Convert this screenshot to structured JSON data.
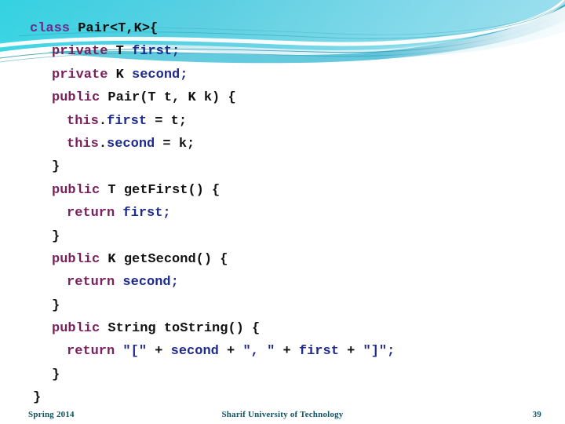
{
  "slide": {
    "page_number": "39",
    "footer": {
      "date": "Spring 2014",
      "organization": "Sharif University of Technology"
    },
    "decoration": {
      "name": "cyan-swoosh-banner",
      "colors": {
        "cyan_bright": "#3fd6e0",
        "cyan_mid": "#5fc8dd",
        "cyan_pale": "#b8e6f0",
        "cyan_line": "#1f8fa5",
        "teal_line": "#2e9fb5",
        "sky": "#7ec9e8"
      }
    },
    "syntax_colors": {
      "keyword": "#7a1f5c",
      "class_keyword": "#6b2a8e",
      "identifier": "#1d2a8f",
      "plain": "#111111"
    }
  },
  "code": {
    "language": "java",
    "lines": [
      {
        "indent": 0,
        "tokens": [
          {
            "t": "class ",
            "c": "cls"
          },
          {
            "t": "Pair<T,K>{",
            "c": "pl"
          }
        ]
      },
      {
        "indent": 1,
        "tokens": [
          {
            "t": "private ",
            "c": "kw"
          },
          {
            "t": "T ",
            "c": "pl"
          },
          {
            "t": "first;",
            "c": "id"
          }
        ]
      },
      {
        "indent": 1,
        "tokens": [
          {
            "t": "private ",
            "c": "kw"
          },
          {
            "t": "K ",
            "c": "pl"
          },
          {
            "t": "second;",
            "c": "id"
          }
        ]
      },
      {
        "indent": 1,
        "tokens": [
          {
            "t": "public ",
            "c": "kw"
          },
          {
            "t": "Pair(T t, K k) {",
            "c": "pl"
          }
        ]
      },
      {
        "indent": 2,
        "tokens": [
          {
            "t": "this",
            "c": "kw"
          },
          {
            "t": ".",
            "c": "pl"
          },
          {
            "t": "first",
            "c": "id"
          },
          {
            "t": " = t;",
            "c": "pl"
          }
        ]
      },
      {
        "indent": 2,
        "tokens": [
          {
            "t": "this",
            "c": "kw"
          },
          {
            "t": ".",
            "c": "pl"
          },
          {
            "t": "second",
            "c": "id"
          },
          {
            "t": " = k;",
            "c": "pl"
          }
        ]
      },
      {
        "indent": 1,
        "tokens": [
          {
            "t": "}",
            "c": "pl"
          }
        ]
      },
      {
        "indent": 1,
        "tokens": [
          {
            "t": "public ",
            "c": "kw"
          },
          {
            "t": "T getFirst() {",
            "c": "pl"
          }
        ]
      },
      {
        "indent": 2,
        "tokens": [
          {
            "t": "return ",
            "c": "kw"
          },
          {
            "t": "first;",
            "c": "id"
          }
        ]
      },
      {
        "indent": 1,
        "tokens": [
          {
            "t": "}",
            "c": "pl"
          }
        ]
      },
      {
        "indent": 1,
        "tokens": [
          {
            "t": "public ",
            "c": "kw"
          },
          {
            "t": "K getSecond() {",
            "c": "pl"
          }
        ]
      },
      {
        "indent": 2,
        "tokens": [
          {
            "t": "return ",
            "c": "kw"
          },
          {
            "t": "second;",
            "c": "id"
          }
        ]
      },
      {
        "indent": 1,
        "tokens": [
          {
            "t": "}",
            "c": "pl"
          }
        ]
      },
      {
        "indent": 1,
        "tokens": [
          {
            "t": "public ",
            "c": "kw"
          },
          {
            "t": "String toString() {",
            "c": "pl"
          }
        ]
      },
      {
        "indent": 2,
        "tokens": [
          {
            "t": "return ",
            "c": "kw"
          },
          {
            "t": "\"[\"",
            "c": "id"
          },
          {
            "t": " + ",
            "c": "pl"
          },
          {
            "t": "second",
            "c": "id"
          },
          {
            "t": " + ",
            "c": "pl"
          },
          {
            "t": "\", \"",
            "c": "id"
          },
          {
            "t": " + ",
            "c": "pl"
          },
          {
            "t": "first",
            "c": "id"
          },
          {
            "t": " + ",
            "c": "pl"
          },
          {
            "t": "\"]\";",
            "c": "id"
          }
        ]
      },
      {
        "indent": 1,
        "tokens": [
          {
            "t": "}",
            "c": "pl"
          }
        ]
      },
      {
        "indent": 3,
        "tokens": [
          {
            "t": "}",
            "c": "pl"
          }
        ]
      }
    ]
  }
}
